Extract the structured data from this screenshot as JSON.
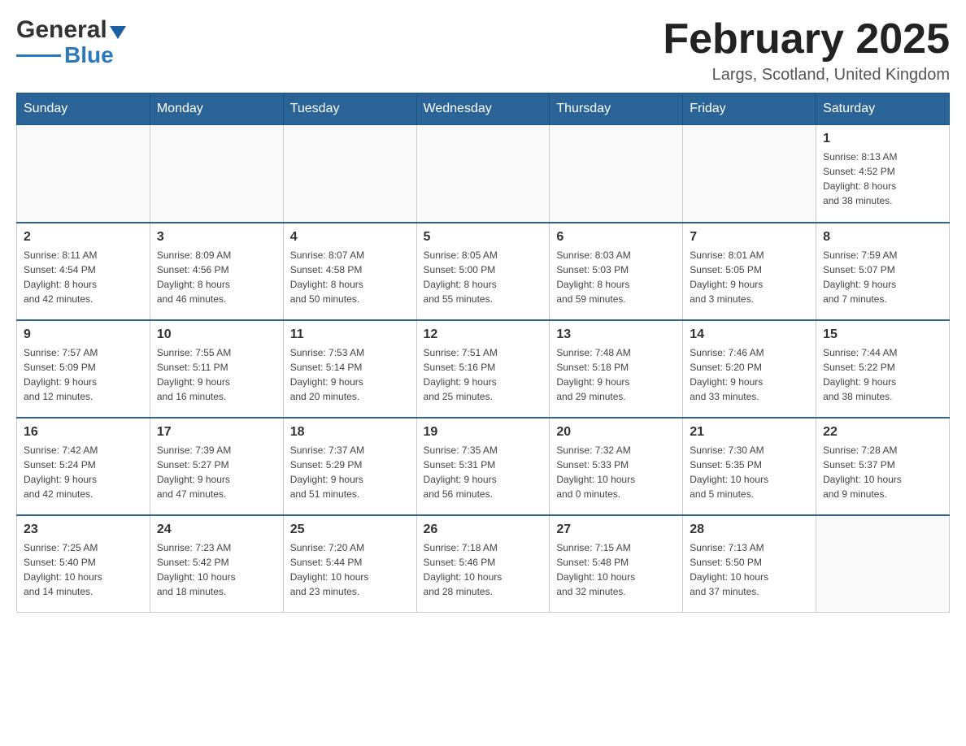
{
  "header": {
    "logo_general": "General",
    "logo_blue": "Blue",
    "month_title": "February 2025",
    "location": "Largs, Scotland, United Kingdom"
  },
  "days_of_week": [
    "Sunday",
    "Monday",
    "Tuesday",
    "Wednesday",
    "Thursday",
    "Friday",
    "Saturday"
  ],
  "weeks": [
    {
      "days": [
        {
          "number": "",
          "info": ""
        },
        {
          "number": "",
          "info": ""
        },
        {
          "number": "",
          "info": ""
        },
        {
          "number": "",
          "info": ""
        },
        {
          "number": "",
          "info": ""
        },
        {
          "number": "",
          "info": ""
        },
        {
          "number": "1",
          "info": "Sunrise: 8:13 AM\nSunset: 4:52 PM\nDaylight: 8 hours\nand 38 minutes."
        }
      ]
    },
    {
      "days": [
        {
          "number": "2",
          "info": "Sunrise: 8:11 AM\nSunset: 4:54 PM\nDaylight: 8 hours\nand 42 minutes."
        },
        {
          "number": "3",
          "info": "Sunrise: 8:09 AM\nSunset: 4:56 PM\nDaylight: 8 hours\nand 46 minutes."
        },
        {
          "number": "4",
          "info": "Sunrise: 8:07 AM\nSunset: 4:58 PM\nDaylight: 8 hours\nand 50 minutes."
        },
        {
          "number": "5",
          "info": "Sunrise: 8:05 AM\nSunset: 5:00 PM\nDaylight: 8 hours\nand 55 minutes."
        },
        {
          "number": "6",
          "info": "Sunrise: 8:03 AM\nSunset: 5:03 PM\nDaylight: 8 hours\nand 59 minutes."
        },
        {
          "number": "7",
          "info": "Sunrise: 8:01 AM\nSunset: 5:05 PM\nDaylight: 9 hours\nand 3 minutes."
        },
        {
          "number": "8",
          "info": "Sunrise: 7:59 AM\nSunset: 5:07 PM\nDaylight: 9 hours\nand 7 minutes."
        }
      ]
    },
    {
      "days": [
        {
          "number": "9",
          "info": "Sunrise: 7:57 AM\nSunset: 5:09 PM\nDaylight: 9 hours\nand 12 minutes."
        },
        {
          "number": "10",
          "info": "Sunrise: 7:55 AM\nSunset: 5:11 PM\nDaylight: 9 hours\nand 16 minutes."
        },
        {
          "number": "11",
          "info": "Sunrise: 7:53 AM\nSunset: 5:14 PM\nDaylight: 9 hours\nand 20 minutes."
        },
        {
          "number": "12",
          "info": "Sunrise: 7:51 AM\nSunset: 5:16 PM\nDaylight: 9 hours\nand 25 minutes."
        },
        {
          "number": "13",
          "info": "Sunrise: 7:48 AM\nSunset: 5:18 PM\nDaylight: 9 hours\nand 29 minutes."
        },
        {
          "number": "14",
          "info": "Sunrise: 7:46 AM\nSunset: 5:20 PM\nDaylight: 9 hours\nand 33 minutes."
        },
        {
          "number": "15",
          "info": "Sunrise: 7:44 AM\nSunset: 5:22 PM\nDaylight: 9 hours\nand 38 minutes."
        }
      ]
    },
    {
      "days": [
        {
          "number": "16",
          "info": "Sunrise: 7:42 AM\nSunset: 5:24 PM\nDaylight: 9 hours\nand 42 minutes."
        },
        {
          "number": "17",
          "info": "Sunrise: 7:39 AM\nSunset: 5:27 PM\nDaylight: 9 hours\nand 47 minutes."
        },
        {
          "number": "18",
          "info": "Sunrise: 7:37 AM\nSunset: 5:29 PM\nDaylight: 9 hours\nand 51 minutes."
        },
        {
          "number": "19",
          "info": "Sunrise: 7:35 AM\nSunset: 5:31 PM\nDaylight: 9 hours\nand 56 minutes."
        },
        {
          "number": "20",
          "info": "Sunrise: 7:32 AM\nSunset: 5:33 PM\nDaylight: 10 hours\nand 0 minutes."
        },
        {
          "number": "21",
          "info": "Sunrise: 7:30 AM\nSunset: 5:35 PM\nDaylight: 10 hours\nand 5 minutes."
        },
        {
          "number": "22",
          "info": "Sunrise: 7:28 AM\nSunset: 5:37 PM\nDaylight: 10 hours\nand 9 minutes."
        }
      ]
    },
    {
      "days": [
        {
          "number": "23",
          "info": "Sunrise: 7:25 AM\nSunset: 5:40 PM\nDaylight: 10 hours\nand 14 minutes."
        },
        {
          "number": "24",
          "info": "Sunrise: 7:23 AM\nSunset: 5:42 PM\nDaylight: 10 hours\nand 18 minutes."
        },
        {
          "number": "25",
          "info": "Sunrise: 7:20 AM\nSunset: 5:44 PM\nDaylight: 10 hours\nand 23 minutes."
        },
        {
          "number": "26",
          "info": "Sunrise: 7:18 AM\nSunset: 5:46 PM\nDaylight: 10 hours\nand 28 minutes."
        },
        {
          "number": "27",
          "info": "Sunrise: 7:15 AM\nSunset: 5:48 PM\nDaylight: 10 hours\nand 32 minutes."
        },
        {
          "number": "28",
          "info": "Sunrise: 7:13 AM\nSunset: 5:50 PM\nDaylight: 10 hours\nand 37 minutes."
        },
        {
          "number": "",
          "info": ""
        }
      ]
    }
  ]
}
